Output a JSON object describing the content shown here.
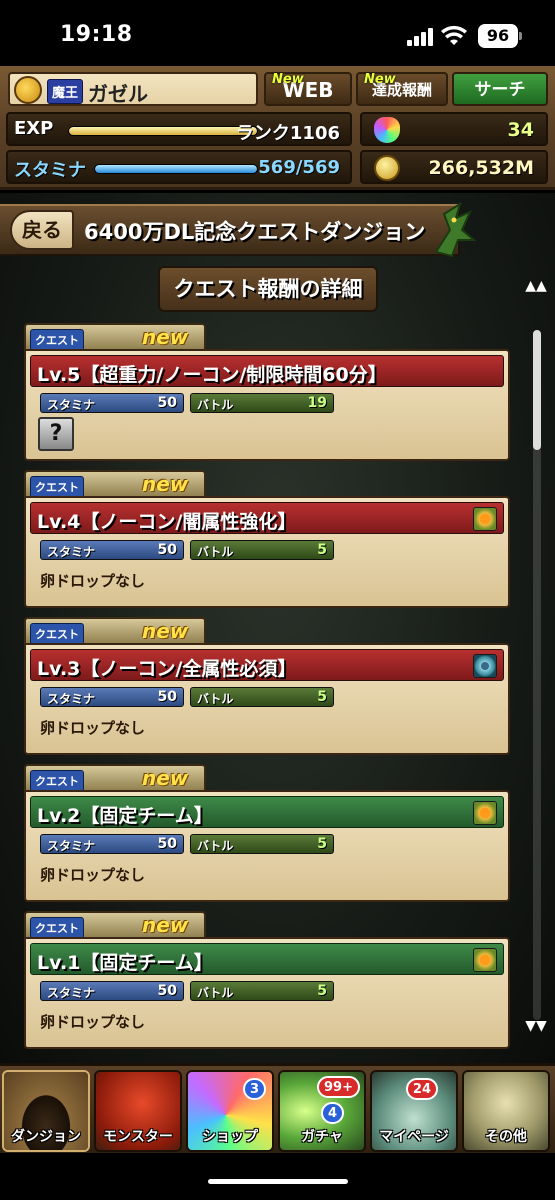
{
  "status_bar": {
    "time": "19:18",
    "battery": "96"
  },
  "player": {
    "rank_badge": "魔王",
    "name": "ガゼル",
    "exp_label": "EXP",
    "rank": "ランク1106",
    "stamina_label": "スタミナ",
    "stamina": "569/569",
    "exp_progress": 1.0,
    "stamina_progress": 1.0,
    "stones": "34",
    "coins": "266,532M"
  },
  "top_buttons": {
    "new_mark": "New",
    "web": "WEB",
    "reward": "達成報酬",
    "search": "サーチ"
  },
  "dungeon": {
    "back_label": "戻る",
    "title": "6400万DL記念クエストダンジョン"
  },
  "section_title": "クエスト報酬の詳細",
  "scroll_up": "▲▲",
  "scroll_down": "▼▼",
  "quest_tab_label": "クエスト",
  "quest_tab_new": "new",
  "stamina_pill_label": "スタミナ",
  "battle_pill_label": "バトル",
  "quests": [
    {
      "name": "Lv.5【超重力/ノーコン/制限時間60分】",
      "stamina": "50",
      "battle": "19",
      "drop": "?",
      "color": "red",
      "attr": ""
    },
    {
      "name": "Lv.4【ノーコン/闇属性強化】",
      "stamina": "50",
      "battle": "5",
      "drop": "卵ドロップなし",
      "color": "red",
      "attr": "sun-icon"
    },
    {
      "name": "Lv.3【ノーコン/全属性必須】",
      "stamina": "50",
      "battle": "5",
      "drop": "卵ドロップなし",
      "color": "red",
      "attr": "swirl-icon"
    },
    {
      "name": "Lv.2【固定チーム】",
      "stamina": "50",
      "battle": "5",
      "drop": "卵ドロップなし",
      "color": "green",
      "attr": "sun-icon"
    },
    {
      "name": "Lv.1【固定チーム】",
      "stamina": "50",
      "battle": "5",
      "drop": "卵ドロップなし",
      "color": "green",
      "attr": "sun-icon"
    }
  ],
  "nav": {
    "dungeon": "ダンジョン",
    "monster": "モンスター",
    "shop": "ショップ",
    "shop_badge": "3",
    "gacha": "ガチャ",
    "gacha_badge_red": "99+",
    "gacha_badge_blue": "4",
    "mypage": "マイページ",
    "mypage_badge": "24",
    "other": "その他"
  }
}
